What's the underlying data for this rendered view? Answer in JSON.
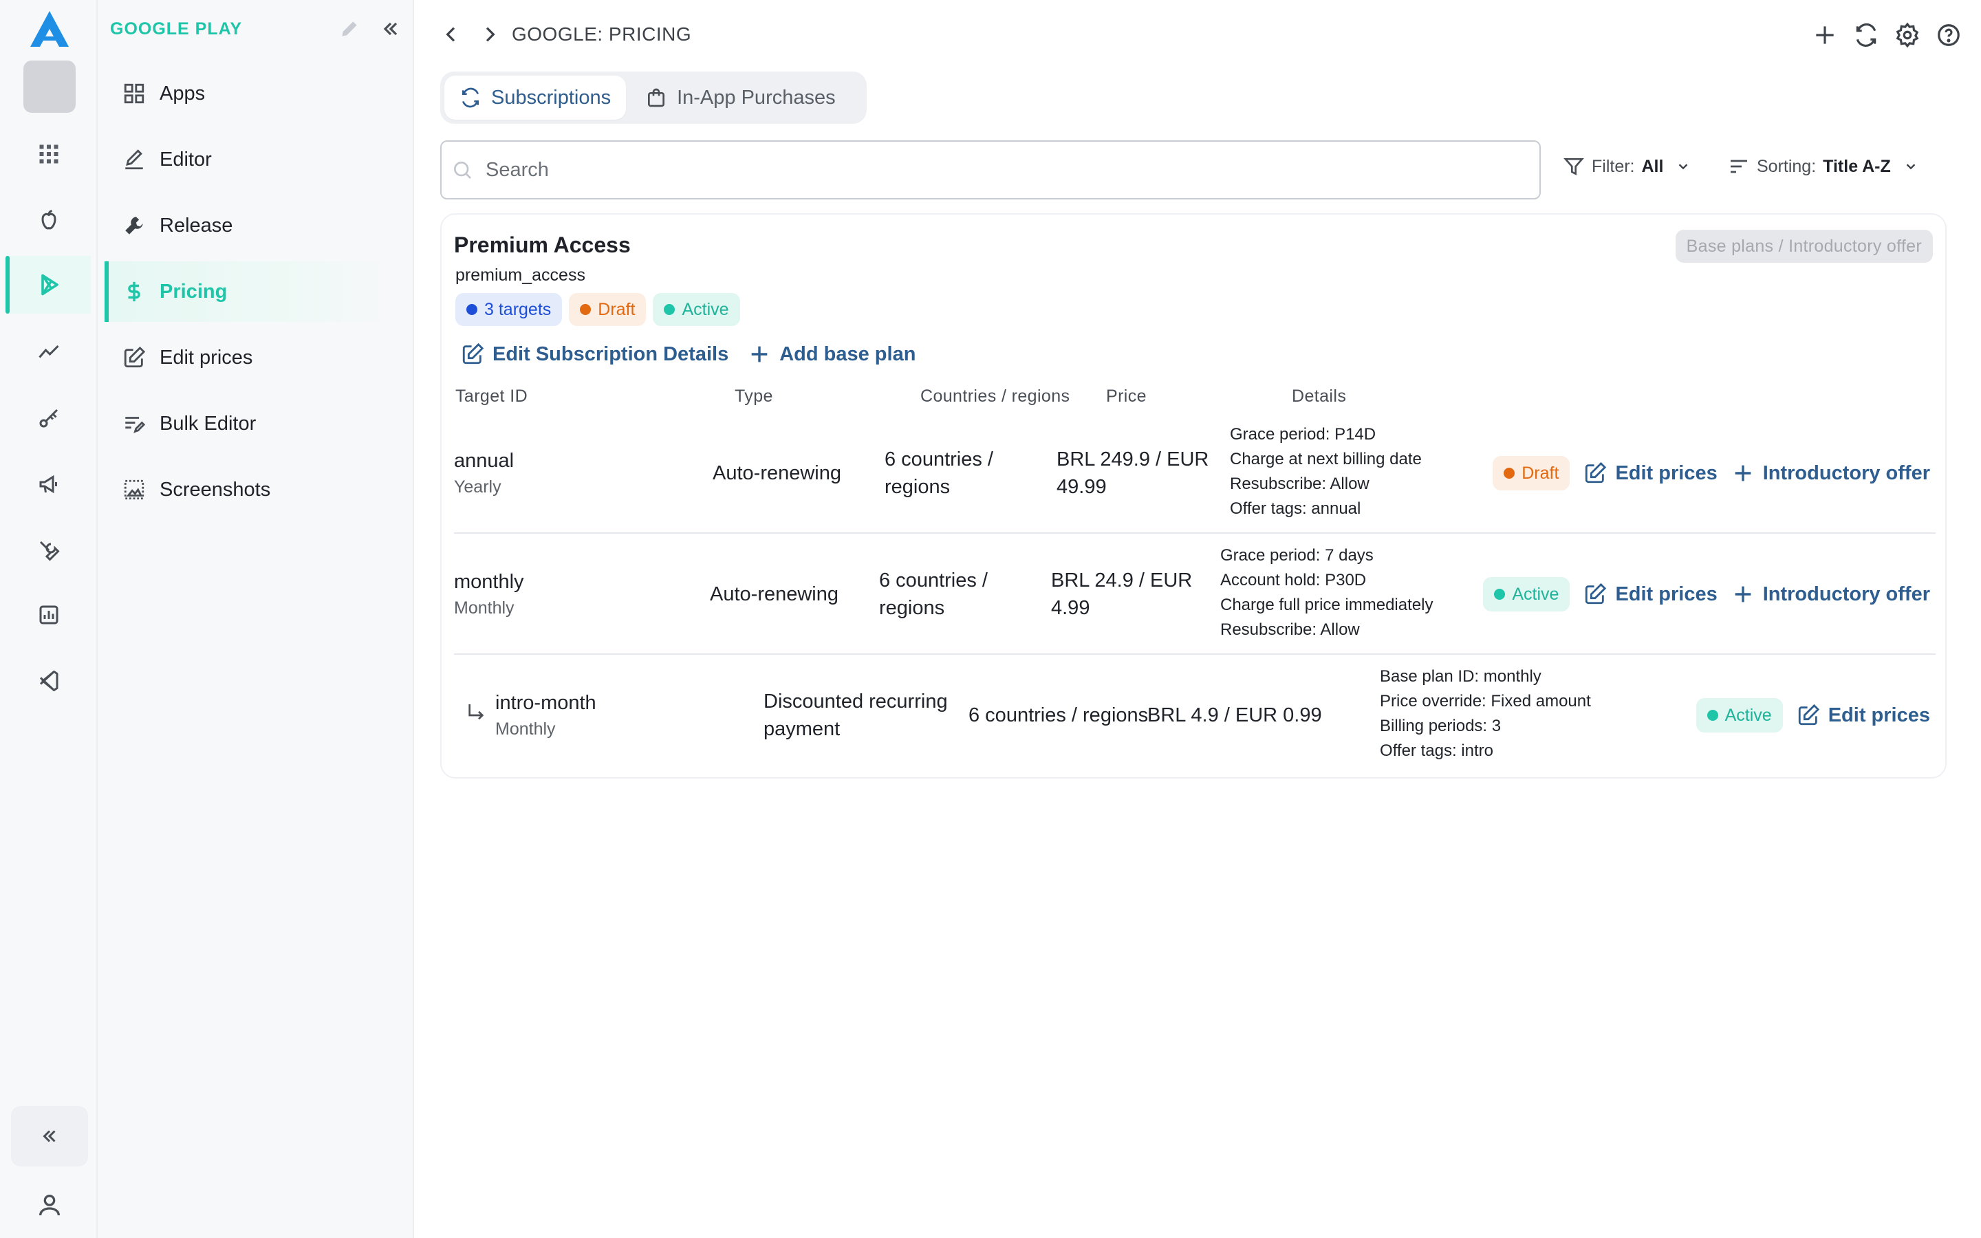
{
  "sidebar": {
    "title": "GOOGLE PLAY",
    "items": [
      {
        "label": "Apps",
        "icon": "grid-icon"
      },
      {
        "label": "Editor",
        "icon": "pen-icon"
      },
      {
        "label": "Release",
        "icon": "wrench-icon"
      },
      {
        "label": "Pricing",
        "icon": "dollar-icon",
        "active": true
      },
      {
        "label": "Edit prices",
        "icon": "edit-square-icon"
      },
      {
        "label": "Bulk Editor",
        "icon": "bulk-list-icon"
      },
      {
        "label": "Screenshots",
        "icon": "screenshot-icon"
      }
    ]
  },
  "rail": {
    "icons": [
      "logo-icon",
      "apps-grid-icon",
      "apple-icon",
      "play-icon",
      "analytics-icon",
      "key-icon",
      "megaphone-icon",
      "tools-icon",
      "chart-icon",
      "vscode-icon"
    ]
  },
  "header": {
    "breadcrumb": "GOOGLE: PRICING"
  },
  "tabs": [
    {
      "label": "Subscriptions",
      "active": true
    },
    {
      "label": "In-App Purchases",
      "active": false
    }
  ],
  "search": {
    "placeholder": "Search"
  },
  "filter": {
    "label": "Filter:",
    "value": "All"
  },
  "sorting": {
    "label": "Sorting:",
    "value": "Title A-Z"
  },
  "card": {
    "title": "Premium Access",
    "id": "premium_access",
    "chips": {
      "targets": "3 targets",
      "draft": "Draft",
      "active": "Active"
    },
    "toggle": "Base plans / Introductory offer",
    "actions": {
      "edit_details": "Edit Subscription Details",
      "add_base_plan": "Add base plan"
    },
    "columns": {
      "target_id": "Target ID",
      "type": "Type",
      "countries": "Countries / regions",
      "price": "Price",
      "details": "Details"
    },
    "rows": [
      {
        "target": "annual",
        "period": "Yearly",
        "type": "Auto-renewing",
        "countries": "6 countries / regions",
        "price": "BRL 249.9 / EUR 49.99",
        "details": [
          "Grace period: P14D",
          "Charge at next billing date",
          "Resubscribe: Allow",
          "Offer tags: annual"
        ],
        "status": "Draft",
        "edit": "Edit prices",
        "intro": "Introductory offer"
      },
      {
        "target": "monthly",
        "period": "Monthly",
        "type": "Auto-renewing",
        "countries": "6 countries / regions",
        "price": "BRL 24.9 / EUR 4.99",
        "details": [
          "Grace period: 7 days",
          "Account hold: P30D",
          "Charge full price immediately",
          "Resubscribe: Allow"
        ],
        "status": "Active",
        "edit": "Edit prices",
        "intro": "Introductory offer"
      },
      {
        "target": "intro-month",
        "period": "Monthly",
        "type": "Discounted recurring payment",
        "countries": "6 countries / regions",
        "price": "BRL 4.9 / EUR 0.99",
        "details": [
          "Base plan ID: monthly",
          "Price override: Fixed amount",
          "Billing periods: 3",
          "Offer tags: intro"
        ],
        "status": "Active",
        "edit": "Edit prices"
      }
    ]
  },
  "colors": {
    "accent": "#1fc5a8",
    "link": "#2e5d8f",
    "draft": "#e2690f",
    "blue": "#1d4ed8"
  }
}
